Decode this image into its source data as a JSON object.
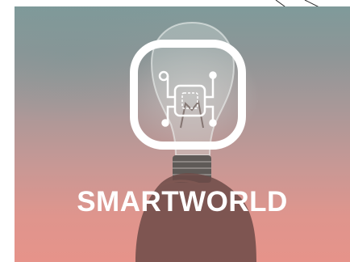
{
  "brand": {
    "name": "SMARTWORLD",
    "logo_icon": "circuit-chip-icon",
    "logo_color": "#ffffff"
  },
  "background": {
    "subject": "hand-holding-lightbulb-photo",
    "colors": {
      "top": "#7f9a9a",
      "bottom": "#e6938a"
    }
  }
}
